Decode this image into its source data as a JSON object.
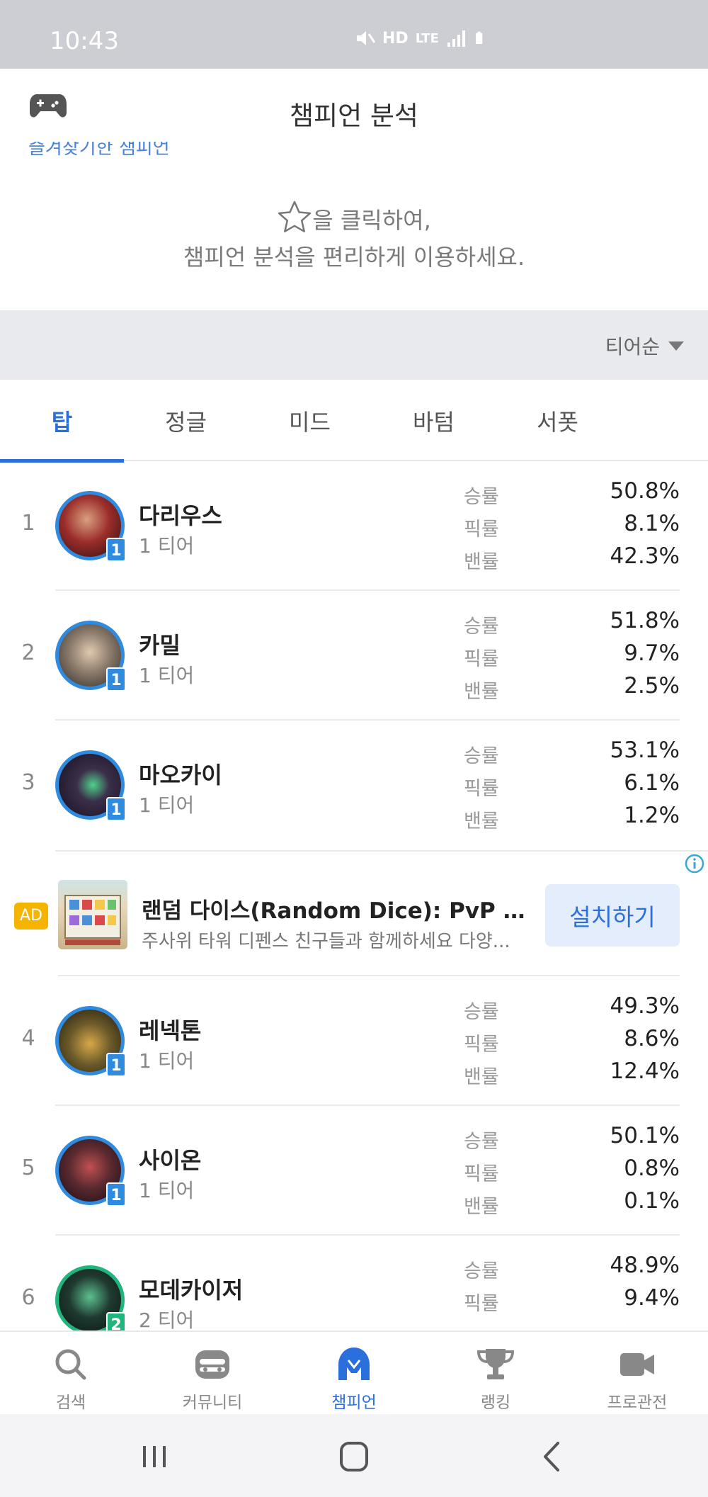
{
  "status_bar": {
    "time": "10:43",
    "hd_label": "HD",
    "lte_label": "LTE"
  },
  "header": {
    "title": "챔피언 분석"
  },
  "cut_text": "즐겨찾기한 챔피언",
  "hint": {
    "line1_suffix": "을 클릭하여,",
    "line2": "챔피언 분석을 편리하게 이용하세요."
  },
  "sort": {
    "label": "티어순"
  },
  "tabs": [
    {
      "label": "탑",
      "active": true
    },
    {
      "label": "정글"
    },
    {
      "label": "미드"
    },
    {
      "label": "바텀"
    },
    {
      "label": "서폿"
    }
  ],
  "stat_labels": {
    "win": "승률",
    "pick": "픽률",
    "ban": "밴률"
  },
  "champions": [
    {
      "rank": "1",
      "name": "다리우스",
      "tier_text": "1 티어",
      "tier_badge": "1",
      "win": "50.8%",
      "pick": "8.1%",
      "ban": "42.3%",
      "color": "#9b2d2a"
    },
    {
      "rank": "2",
      "name": "카밀",
      "tier_text": "1 티어",
      "tier_badge": "1",
      "win": "51.8%",
      "pick": "9.7%",
      "ban": "2.5%",
      "color": "#8a7a6a"
    },
    {
      "rank": "3",
      "name": "마오카이",
      "tier_text": "1 티어",
      "tier_badge": "1",
      "win": "53.1%",
      "pick": "6.1%",
      "ban": "1.2%",
      "color": "#3b2f4a"
    },
    {
      "rank": "4",
      "name": "레넥톤",
      "tier_text": "1 티어",
      "tier_badge": "1",
      "win": "49.3%",
      "pick": "8.6%",
      "ban": "12.4%",
      "color": "#6b5a2a"
    },
    {
      "rank": "5",
      "name": "사이온",
      "tier_text": "1 티어",
      "tier_badge": "1",
      "win": "50.1%",
      "pick": "0.8%",
      "ban": "0.1%",
      "color": "#5a2a30"
    },
    {
      "rank": "6",
      "name": "모데카이저",
      "tier_text": "2 티어",
      "tier_badge": "2",
      "win": "48.9%",
      "pick": "9.4%",
      "ban": "",
      "color": "#1f3a30"
    }
  ],
  "ad": {
    "badge": "AD",
    "title": "랜덤 다이스(Random Dice): PvP 디펜...",
    "desc": "주사위 타워 디펜스 친구들과 함께하세요 다양...",
    "install": "설치하기"
  },
  "bottom_nav": [
    {
      "label": "검색",
      "icon": "search-icon"
    },
    {
      "label": "커뮤니티",
      "icon": "community-icon"
    },
    {
      "label": "챔피언",
      "icon": "champion-helmet-icon",
      "active": true
    },
    {
      "label": "랭킹",
      "icon": "trophy-icon"
    },
    {
      "label": "프로관전",
      "icon": "video-camera-icon"
    }
  ],
  "colors": {
    "accent": "#2a6fdb",
    "tier1": "#2e8be0",
    "tier2": "#1fb57c",
    "ad_badge": "#f4b400"
  }
}
